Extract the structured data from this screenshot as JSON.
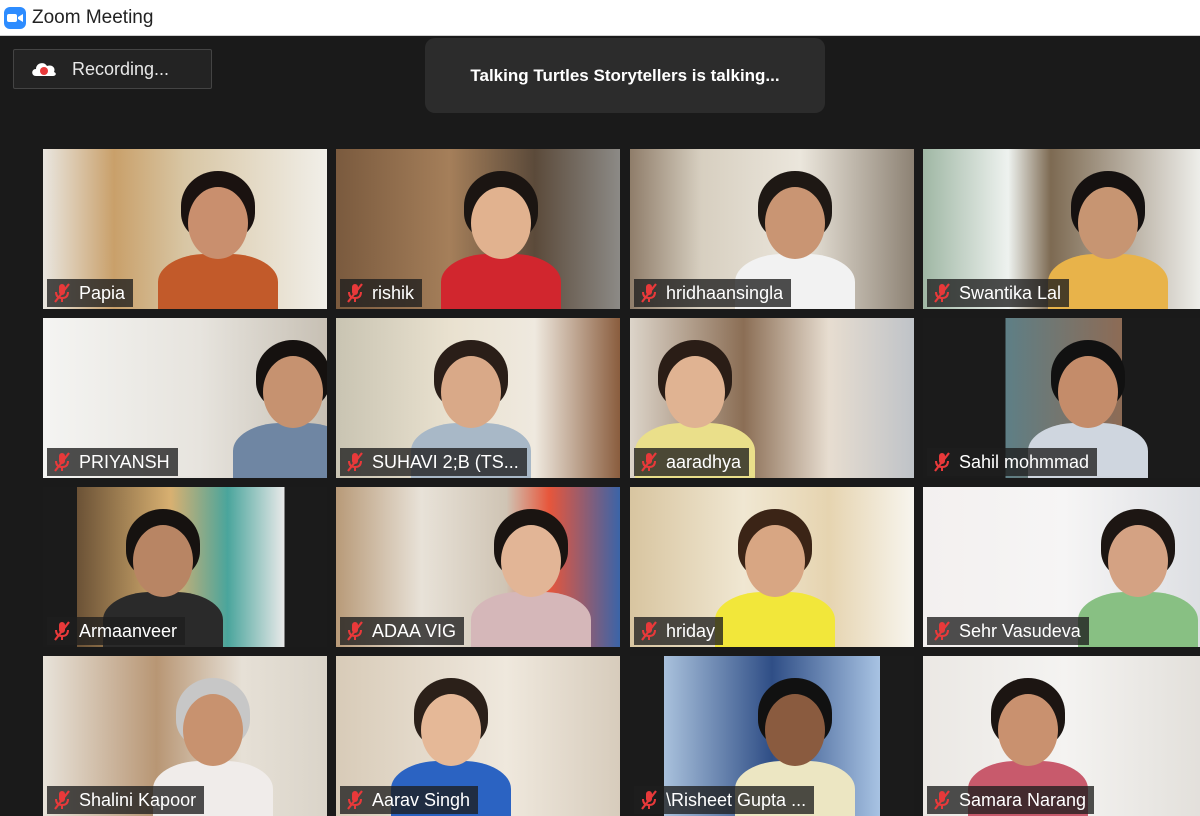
{
  "window": {
    "title": "Zoom Meeting",
    "app_icon": "zoom-camera-icon",
    "accent_color": "#2d8cff"
  },
  "toolbar": {
    "recording_label": "Recording...",
    "recording_icon": "cloud-record-icon"
  },
  "speaker_banner": {
    "text": "Talking Turtles Storytellers is talking..."
  },
  "participants": [
    {
      "name": "Papia",
      "muted": true
    },
    {
      "name": "rishik",
      "muted": true
    },
    {
      "name": "hridhaansingla",
      "muted": true
    },
    {
      "name": "Swantika Lal",
      "muted": true
    },
    {
      "name": "PRIYANSH",
      "muted": true
    },
    {
      "name": "SUHAVI 2;B (TS...",
      "muted": true
    },
    {
      "name": "aaradhya",
      "muted": true
    },
    {
      "name": "Sahil mohmmad",
      "muted": true
    },
    {
      "name": "Armaanveer",
      "muted": true
    },
    {
      "name": "ADAA VIG",
      "muted": true
    },
    {
      "name": "hriday",
      "muted": true
    },
    {
      "name": "Sehr Vasudeva",
      "muted": true
    },
    {
      "name": "Shalini Kapoor",
      "muted": true
    },
    {
      "name": "Aarav Singh",
      "muted": true
    },
    {
      "name": "\\Risheet Gupta ...",
      "muted": true
    },
    {
      "name": "Samara Narang",
      "muted": true
    }
  ],
  "colors": {
    "background": "#1a1a1a",
    "mute_icon": "#e8393a"
  }
}
